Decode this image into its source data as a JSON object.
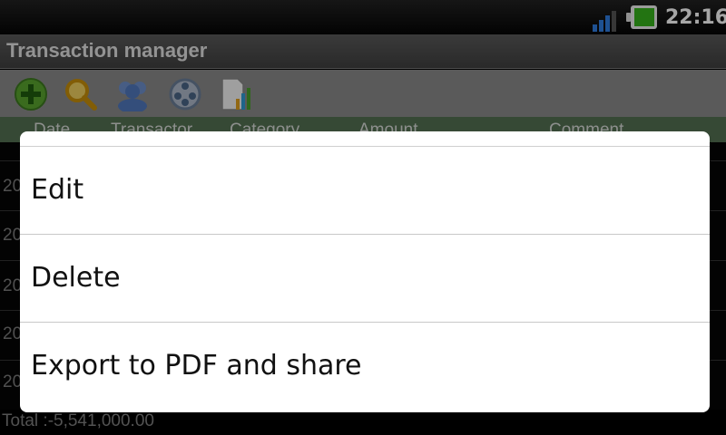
{
  "status_bar": {
    "time": "22:16",
    "battery_color": "#36b31c",
    "signal_color": "#2f7de0"
  },
  "app": {
    "title": "Transaction manager"
  },
  "toolbar": {
    "icons": [
      "add-icon",
      "search-icon",
      "people-icon",
      "film-reel-icon",
      "report-icon"
    ]
  },
  "table": {
    "columns": [
      "Date",
      "Transactor",
      "Category",
      "Amount",
      "Comment"
    ],
    "row_stubs": [
      "20",
      "20",
      "20",
      "20",
      "20"
    ]
  },
  "footer": {
    "total": "Total :-5,541,000.00"
  },
  "context_menu": {
    "items": [
      {
        "label": "Edit"
      },
      {
        "label": "Delete"
      },
      {
        "label": "Export to PDF and share"
      }
    ]
  }
}
